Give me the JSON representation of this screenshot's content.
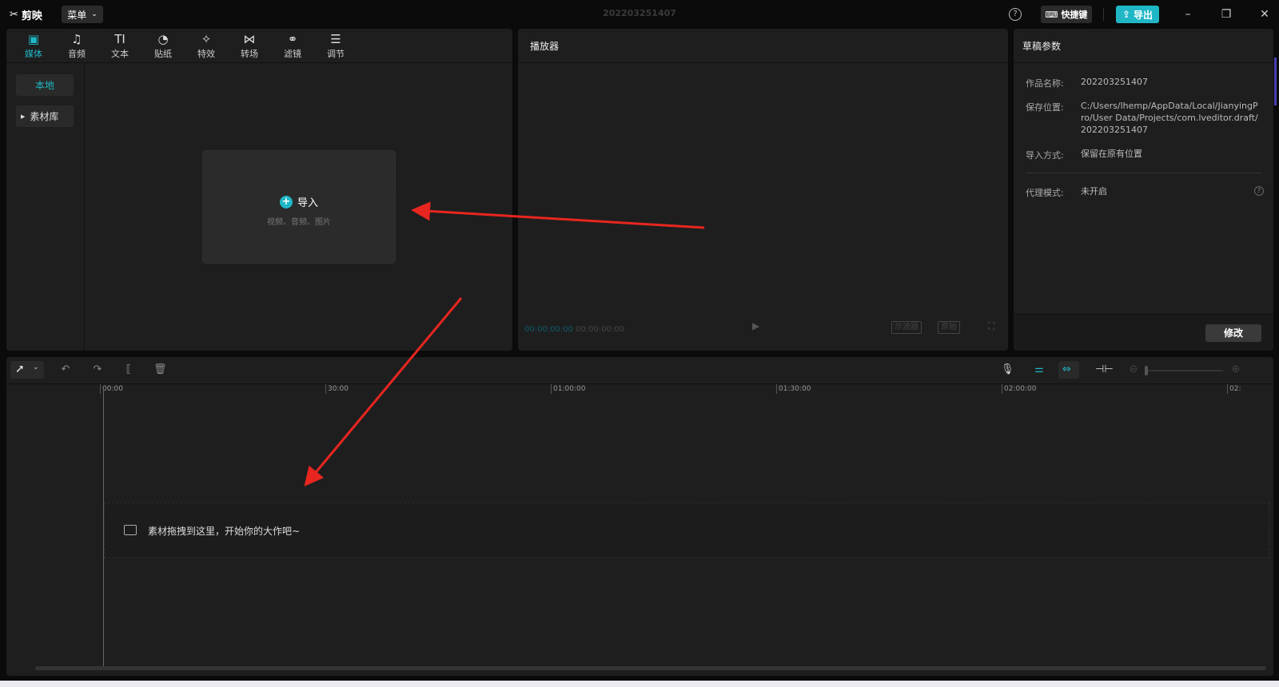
{
  "titlebar": {
    "app_name": "剪映",
    "menu_label": "菜单",
    "project_title": "202203251407",
    "shortcut_label": "快捷键",
    "export_label": "导出",
    "help_glyph": "?"
  },
  "media": {
    "tabs": [
      {
        "label": "媒体",
        "icon": "media-icon",
        "glyph": "▣"
      },
      {
        "label": "音频",
        "icon": "audio-icon",
        "glyph": "♫"
      },
      {
        "label": "文本",
        "icon": "text-icon",
        "glyph": "TI"
      },
      {
        "label": "贴纸",
        "icon": "sticker-icon",
        "glyph": "◔"
      },
      {
        "label": "特效",
        "icon": "effects-icon",
        "glyph": "✧"
      },
      {
        "label": "转场",
        "icon": "transition-icon",
        "glyph": "⋈"
      },
      {
        "label": "滤镜",
        "icon": "filter-icon",
        "glyph": "⚭"
      },
      {
        "label": "调节",
        "icon": "adjust-icon",
        "glyph": "☰"
      }
    ],
    "side_local": "本地",
    "side_library": "素材库",
    "import_label": "导入",
    "import_sub": "视频、音频、图片"
  },
  "player": {
    "title": "播放器",
    "current_time": "00:00:00:00",
    "total_time": "00:00:00:00",
    "scope_btn": "示波器",
    "ratio_btn": "原始"
  },
  "draft": {
    "title": "草稿参数",
    "name_label": "作品名称:",
    "name_value": "202203251407",
    "path_label": "保存位置:",
    "path_value": "C:/Users/lhemp/AppData/Local/JianyingPro/User Data/Projects/com.lveditor.draft/202203251407",
    "import_label": "导入方式:",
    "import_value": "保留在原有位置",
    "proxy_label": "代理模式:",
    "proxy_value": "未开启",
    "modify_label": "修改"
  },
  "timeline": {
    "ticks": [
      "00:00",
      "30:00",
      "01:00:00",
      "01:30:00",
      "02:00:00",
      "02:"
    ],
    "drop_hint": "素材拖拽到这里，开始你的大作吧~"
  }
}
